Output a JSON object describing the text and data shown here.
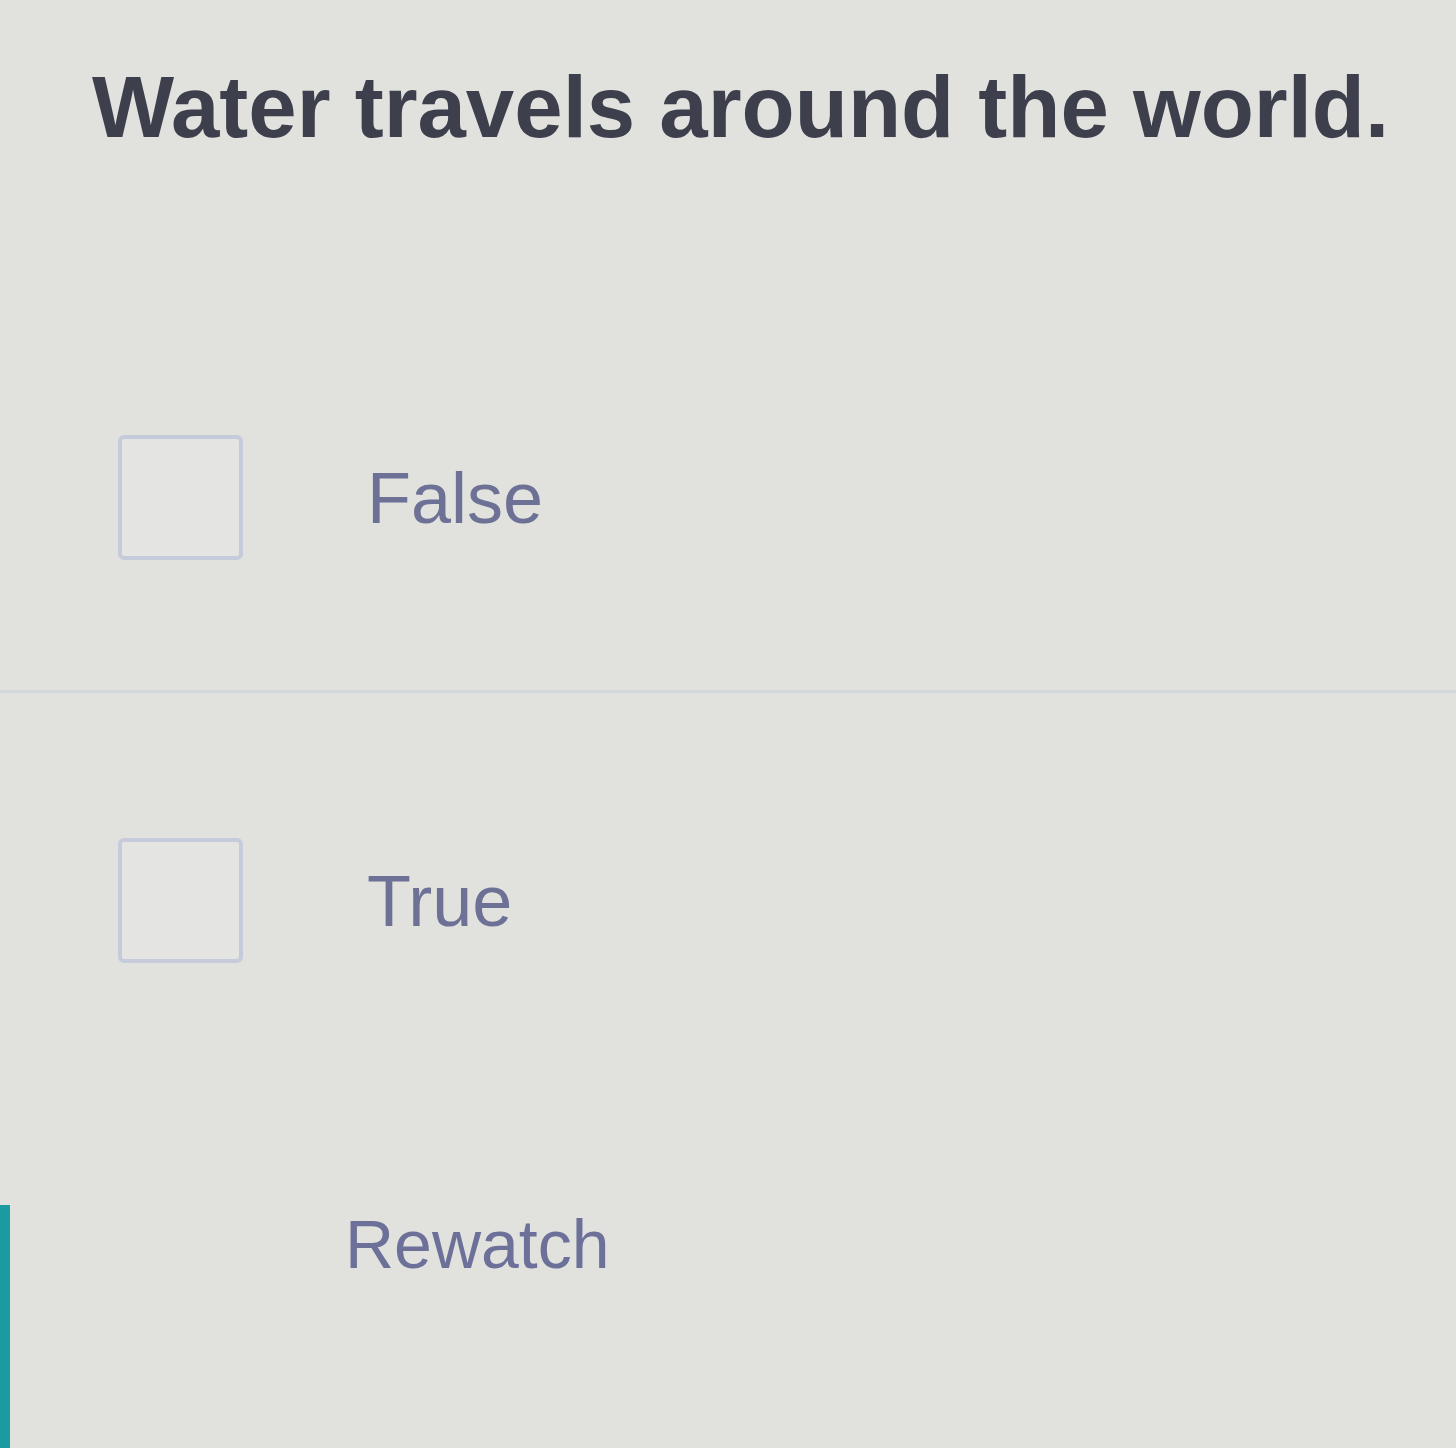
{
  "question": {
    "text": "Water travels around the world."
  },
  "options": [
    {
      "label": "False",
      "checked": false
    },
    {
      "label": "True",
      "checked": false
    }
  ],
  "rewatch_button": {
    "label": "Rewatch"
  }
}
